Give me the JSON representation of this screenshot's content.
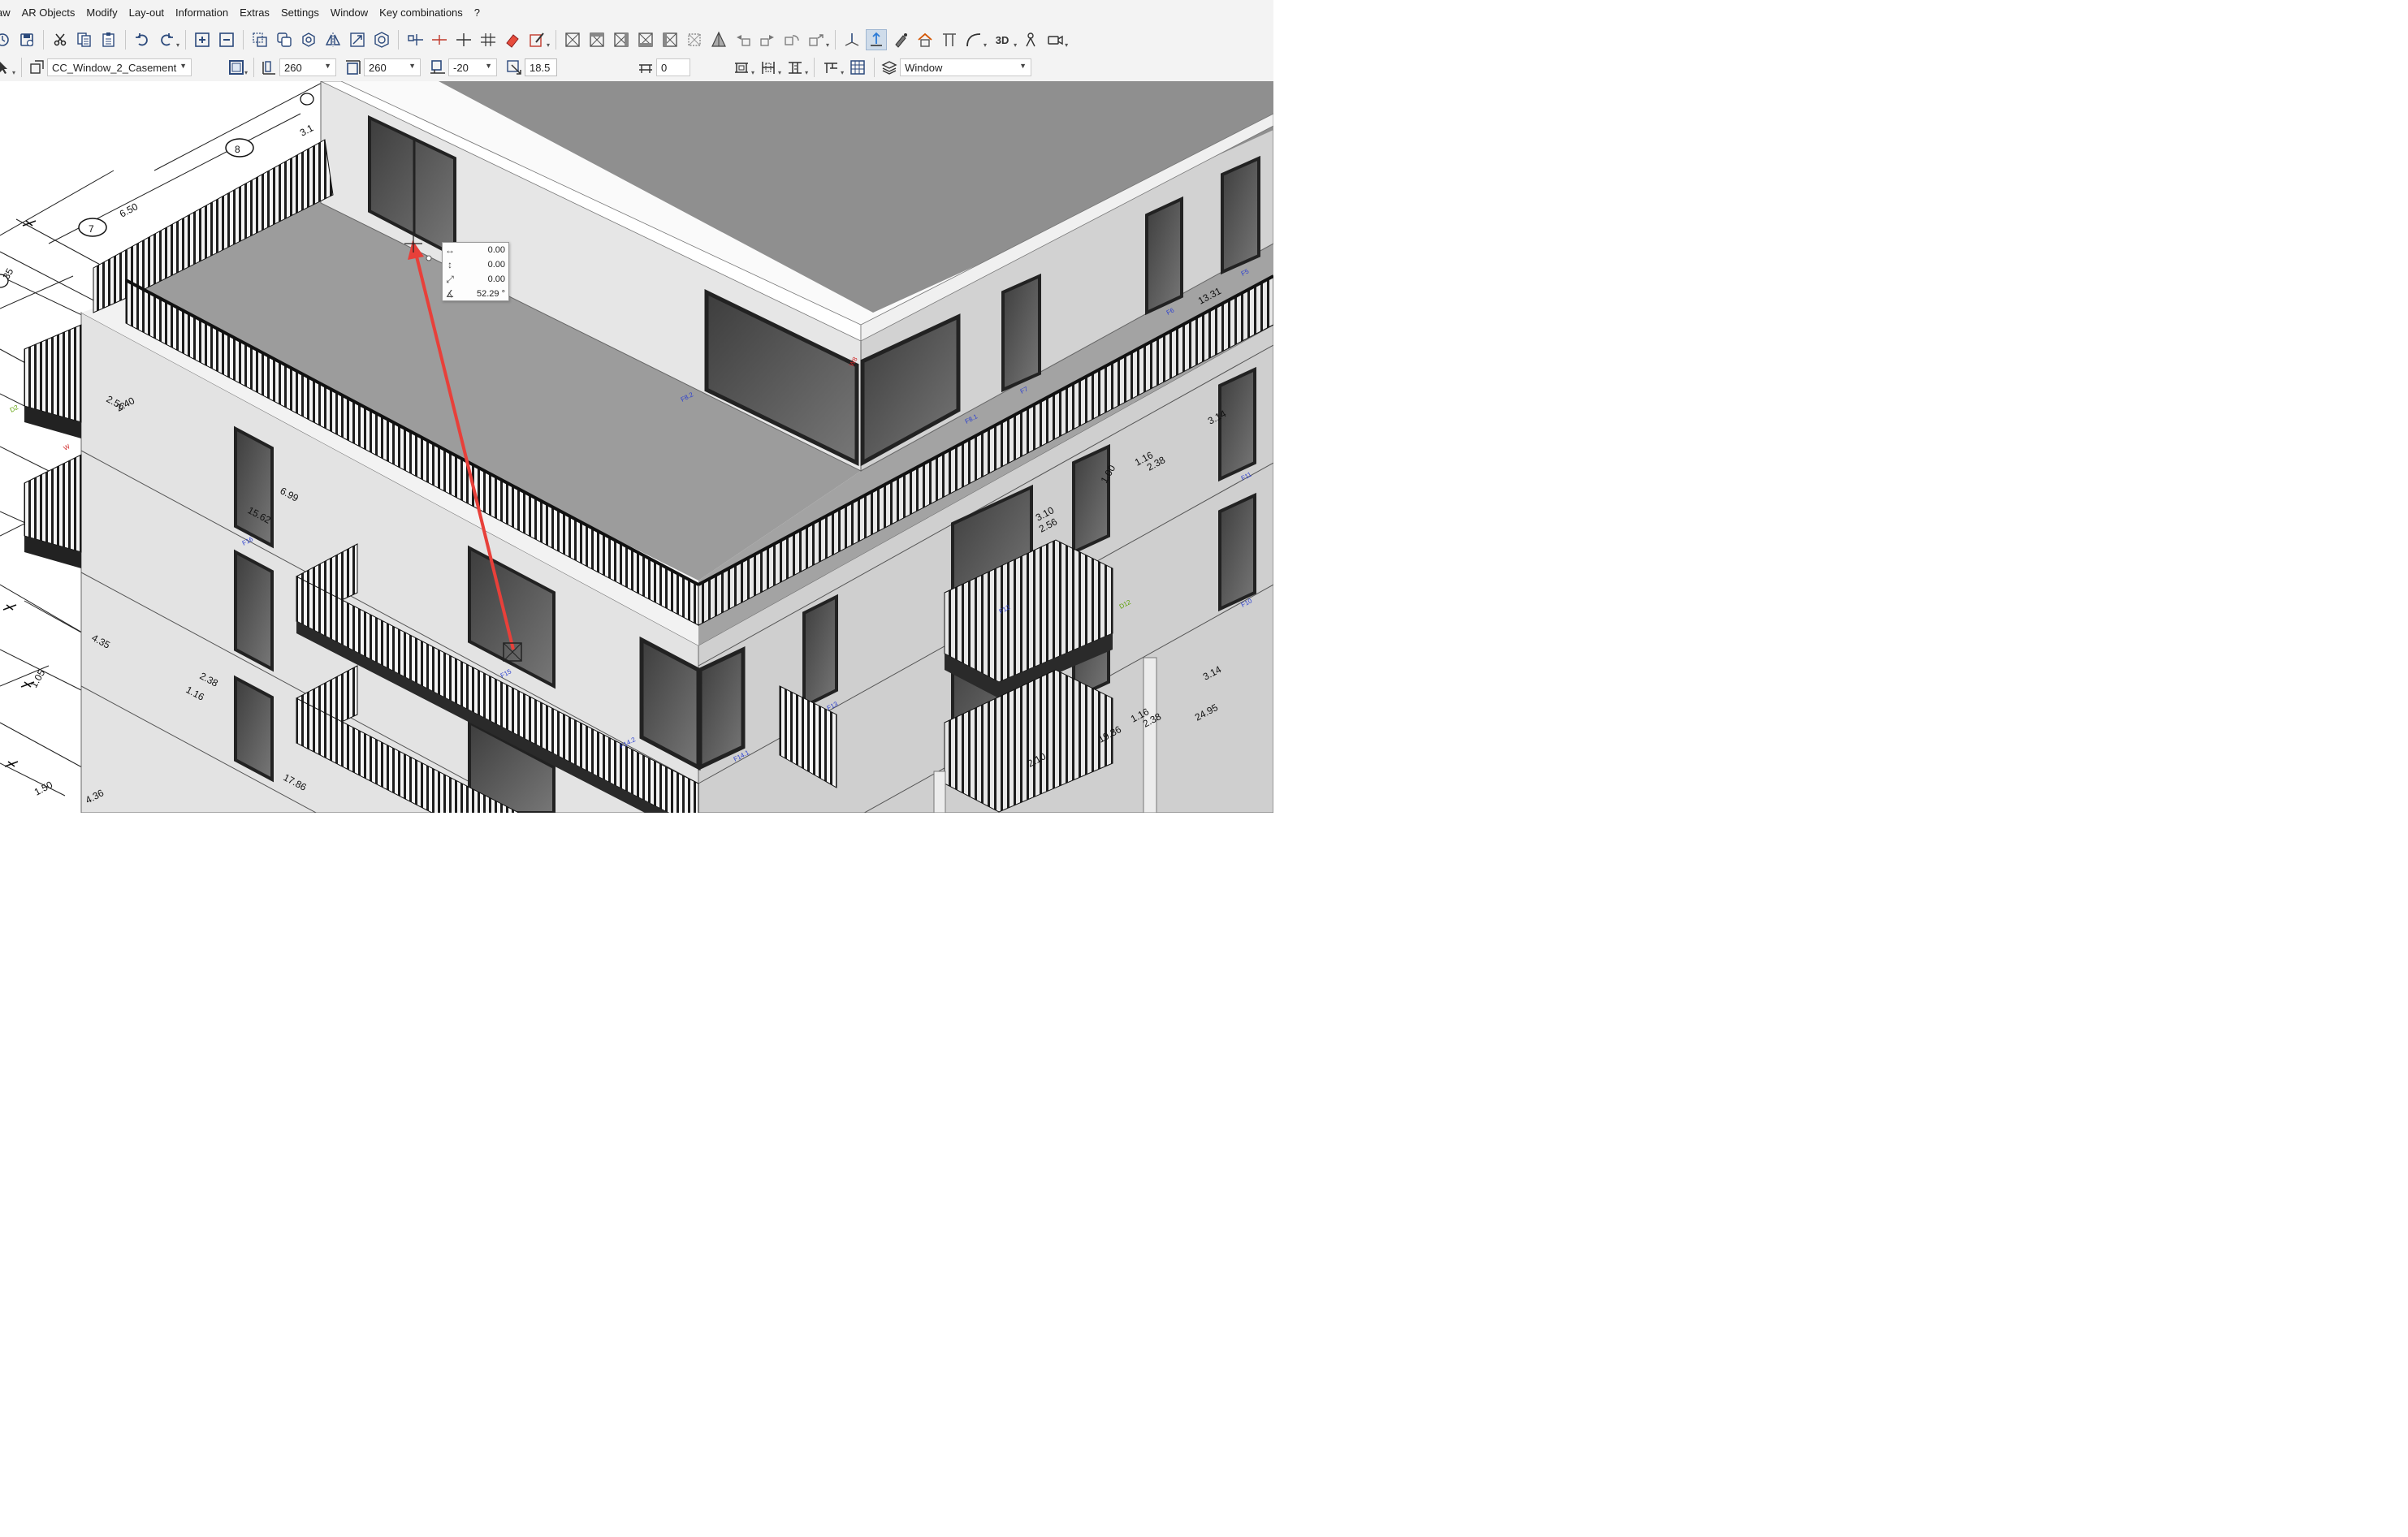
{
  "menu": [
    "aw",
    "AR Objects",
    "Modify",
    "Lay-out",
    "Information",
    "Extras",
    "Settings",
    "Window",
    "Key combinations",
    "?"
  ],
  "properties_bar": {
    "object_name": "CC_Window_2_Casement",
    "width": "260",
    "height": "260",
    "sill_offset": "-20",
    "reveal": "18.5",
    "parapet": "0",
    "layer": "Window"
  },
  "coord_tooltip": {
    "dx": "0.00",
    "dy": "0.00",
    "dist": "0.00",
    "angle": "52.29 °"
  },
  "dimensions": {
    "axis7": "7",
    "axis8": "8",
    "d650": "6.50",
    "d31": "3.1",
    "d35a": "35",
    "d240": "2.40",
    "d256": "2.56",
    "d699": "6.99",
    "d1562": "15.62",
    "d435": "4.35",
    "d105": "1.05",
    "d116a": "1.16",
    "d238a": "2.38",
    "d150": "1.50",
    "d4365": "4.36",
    "d1786": "17.86",
    "d1331": "13.31",
    "d314": "3.14",
    "d116b": "1.16",
    "d238b": "2.38",
    "d310": "3.10",
    "d256b": "2.56",
    "d314b": "3.14",
    "d116c": "1.16",
    "d238c": "2.38",
    "d2495": "24.95",
    "d1936": "19.36",
    "d210": "2.10",
    "d100": "1.00"
  },
  "window_tags": [
    "F8.2",
    "F7",
    "F8.1",
    "W8",
    "F6",
    "F5",
    "F15",
    "F16",
    "F14.2",
    "F14.1",
    "F13",
    "F12",
    "F11",
    "F10",
    "D12",
    "W",
    "D2"
  ],
  "colors": {
    "accent": "#2c4a7c",
    "arrow": "#e8403a",
    "railing": "#1e1e1e",
    "roof": "#8d8d8d",
    "wall": "#e6e6e6"
  }
}
